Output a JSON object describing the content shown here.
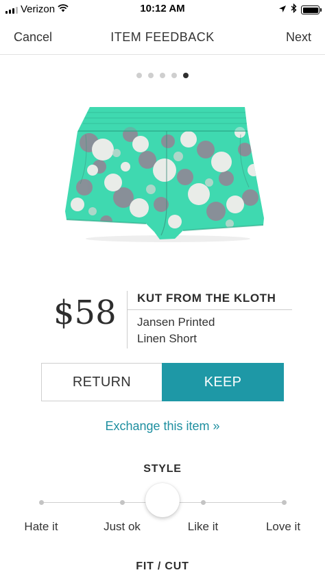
{
  "status_bar": {
    "carrier": "Verizon",
    "time": "10:12 AM"
  },
  "nav": {
    "cancel_label": "Cancel",
    "title": "ITEM FEEDBACK",
    "next_label": "Next"
  },
  "pager": {
    "total": 5,
    "active_index": 4
  },
  "product": {
    "price": "$58",
    "brand": "KUT FROM THE KLOTH",
    "name_line1": "Jansen Printed",
    "name_line2": "Linen Short"
  },
  "actions": {
    "return_label": "RETURN",
    "keep_label": "KEEP",
    "exchange_label": "Exchange this item »"
  },
  "style": {
    "title": "STYLE",
    "options": [
      "Hate it",
      "Just ok",
      "Like it",
      "Love it"
    ],
    "selected_position": 1.5
  },
  "fit": {
    "title": "FIT / CUT"
  },
  "colors": {
    "accent": "#1e98a6",
    "link": "#1e8fa0",
    "shorts_mint": "#3fd9b0",
    "flower_gray": "#8d8c97",
    "flower_white": "#e9ece8"
  },
  "icons": {
    "wifi": "wifi-icon",
    "location": "location-arrow-icon",
    "bluetooth": "bluetooth-icon",
    "battery": "battery-icon"
  }
}
